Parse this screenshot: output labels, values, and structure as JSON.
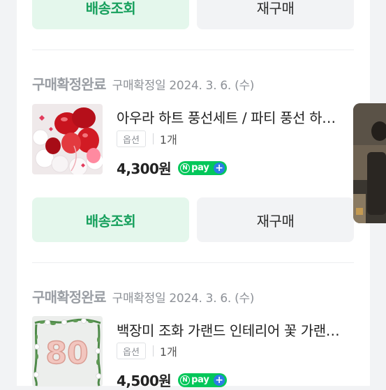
{
  "buttons": {
    "track_label": "배송조회",
    "rebuy_label": "재구매"
  },
  "orders": [
    {
      "status": "구매확정완료",
      "date": "구매확정일 2024. 3. 6. (수)",
      "product_name": "아우라 하트 풍선세트 / 파티 풍선 하트 풍선",
      "option_label": "옵션",
      "quantity": "1개",
      "price": "4,300원",
      "npay": {
        "n": "N",
        "label": "pay",
        "plus": "+"
      }
    },
    {
      "status": "구매확정완료",
      "date": "구매확정일 2024. 3. 6. (수)",
      "product_name": "백장미 조화 가랜드 인테리어 꽃 가랜드 장식",
      "option_label": "옵션",
      "quantity": "1개",
      "price": "4,500원",
      "npay": {
        "n": "N",
        "label": "pay",
        "plus": "+"
      },
      "thumbnail_text": "80"
    }
  ],
  "colors": {
    "accent_green": "#17a05d",
    "track_bg": "#e4f7ec",
    "npay_green": "#03c75a",
    "npay_blue": "#2c7be5"
  }
}
